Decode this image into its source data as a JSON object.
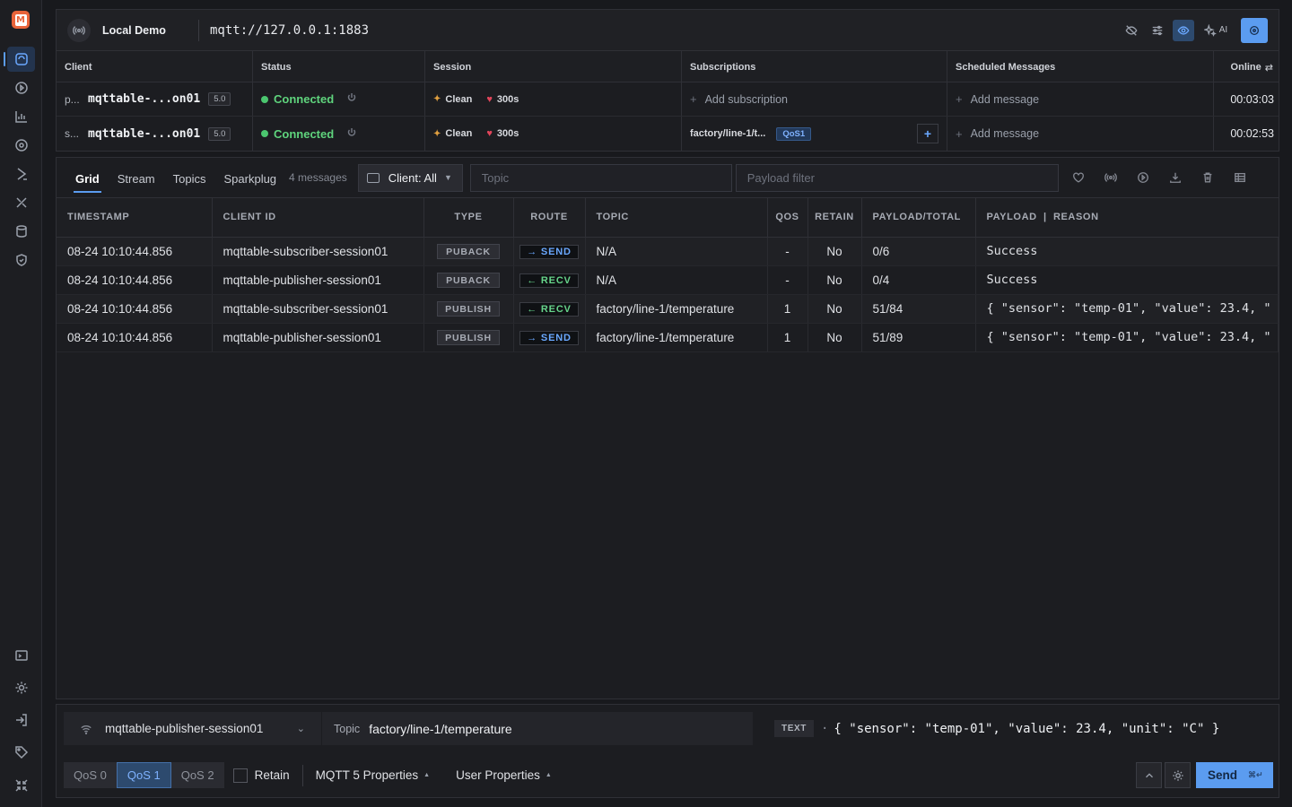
{
  "connection": {
    "name": "Local Demo",
    "url": "mqtt://127.0.0.1:1883",
    "ai_label": "AI"
  },
  "clients_table": {
    "headers": [
      "Client",
      "Status",
      "Session",
      "Subscriptions",
      "Scheduled Messages",
      "Online"
    ],
    "rows": [
      {
        "prefix": "p...",
        "name": "mqttable-...on01",
        "version": "5.0",
        "status": "Connected",
        "clean": "Clean",
        "keepalive": "300s",
        "subscription": "",
        "add_subscription": "Add subscription",
        "qos_tag": "",
        "add_message": "Add message",
        "online": "00:03:03"
      },
      {
        "prefix": "s...",
        "name": "mqttable-...on01",
        "version": "5.0",
        "status": "Connected",
        "clean": "Clean",
        "keepalive": "300s",
        "subscription": "factory/line-1/t...",
        "qos_tag": "QoS1",
        "add_message": "Add message",
        "online": "00:02:53"
      }
    ]
  },
  "messages": {
    "tabs": [
      "Grid",
      "Stream",
      "Topics",
      "Sparkplug"
    ],
    "active_tab": "Grid",
    "count": "4 messages",
    "client_filter": "Client: All",
    "topic_placeholder": "Topic",
    "payload_placeholder": "Payload filter",
    "columns": [
      "TIMESTAMP",
      "CLIENT ID",
      "TYPE",
      "ROUTE",
      "TOPIC",
      "QOS",
      "RETAIN",
      "PAYLOAD/TOTAL",
      "PAYLOAD  |  REASON"
    ],
    "rows": [
      {
        "timestamp": "08-24 10:10:44.856",
        "client_id": "mqttable-subscriber-session01",
        "type": "PUBACK",
        "route": "→ SEND",
        "route_dir": "send",
        "topic": "N/A",
        "qos": "-",
        "retain": "No",
        "size": "0/6",
        "payload": "Success"
      },
      {
        "timestamp": "08-24 10:10:44.856",
        "client_id": "mqttable-publisher-session01",
        "type": "PUBACK",
        "route": "← RECV",
        "route_dir": "recv",
        "topic": "N/A",
        "qos": "-",
        "retain": "No",
        "size": "0/4",
        "payload": "Success"
      },
      {
        "timestamp": "08-24 10:10:44.856",
        "client_id": "mqttable-subscriber-session01",
        "type": "PUBLISH",
        "route": "← RECV",
        "route_dir": "recv",
        "topic": "factory/line-1/temperature",
        "qos": "1",
        "retain": "No",
        "size": "51/84",
        "payload": "{ \"sensor\": \"temp-01\", \"value\": 23.4, \""
      },
      {
        "timestamp": "08-24 10:10:44.856",
        "client_id": "mqttable-publisher-session01",
        "type": "PUBLISH",
        "route": "→ SEND",
        "route_dir": "send",
        "topic": "factory/line-1/temperature",
        "qos": "1",
        "retain": "No",
        "size": "51/89",
        "payload": "{ \"sensor\": \"temp-01\", \"value\": 23.4, \""
      }
    ]
  },
  "composer": {
    "session": "mqttable-publisher-session01",
    "topic_label": "Topic",
    "topic": "factory/line-1/temperature",
    "format": "TEXT",
    "payload": "{ \"sensor\": \"temp-01\", \"value\": 23.4, \"unit\": \"C\" }",
    "qos_options": [
      "QoS 0",
      "QoS 1",
      "QoS 2"
    ],
    "qos_selected": "QoS 1",
    "retain_label": "Retain",
    "mqtt5_label": "MQTT 5 Properties",
    "user_props_label": "User Properties",
    "send_label": "Send",
    "send_shortcut": "⌘↵"
  },
  "colors": {
    "accent": "#5b9cf0",
    "connected": "#5fd47d",
    "send": "#6aa8ff",
    "recv": "#66d48a",
    "logo": "#e8643a"
  }
}
